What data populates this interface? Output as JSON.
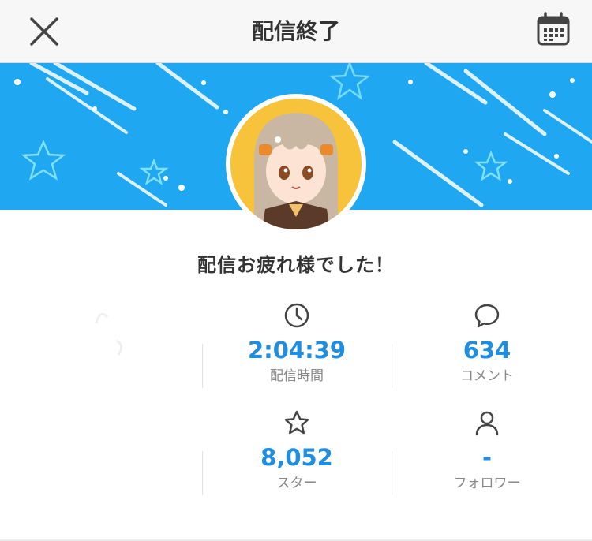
{
  "header": {
    "title": "配信終了",
    "close_icon": "close-icon",
    "calendar_icon": "calendar-icon"
  },
  "banner": {
    "background_color": "#1fa7f2"
  },
  "main": {
    "message": "配信お疲れ様でした！",
    "stats": [
      {
        "icon": "clock-icon",
        "value": "2:04:39",
        "label": "配信時間"
      },
      {
        "icon": "comment-icon",
        "value": "634",
        "label": "コメント"
      },
      {
        "icon": "star-icon",
        "value": "8,052",
        "label": "スター"
      },
      {
        "icon": "person-icon",
        "value": "-",
        "label": "フォロワー"
      }
    ]
  },
  "colors": {
    "accent": "#1f8de0",
    "label": "#888888"
  }
}
